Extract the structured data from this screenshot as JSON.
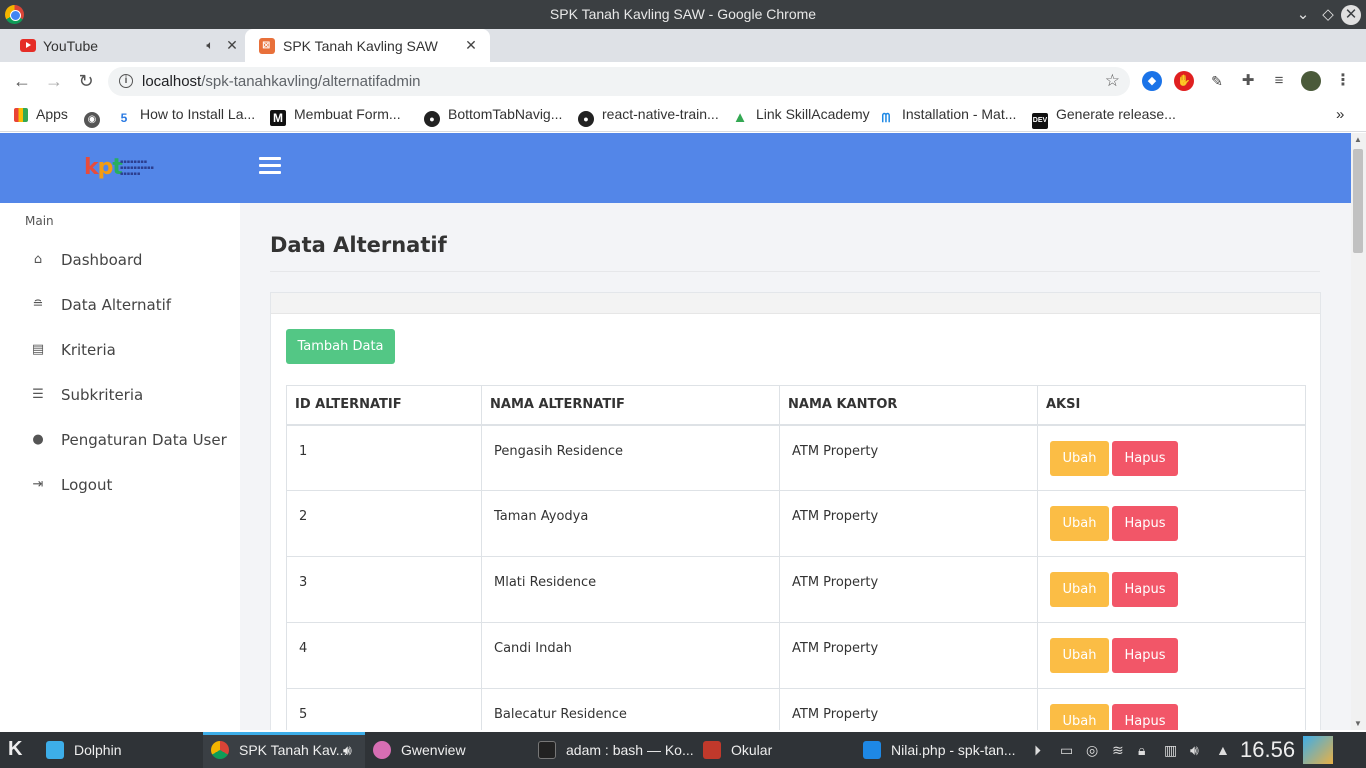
{
  "window": {
    "title": "SPK Tanah Kavling SAW - Google Chrome"
  },
  "tabs": [
    {
      "label": "YouTube"
    },
    {
      "label": "SPK Tanah Kavling SAW"
    }
  ],
  "address": {
    "host": "localhost",
    "path": "/spk-tanahkavling/alternatifadmin"
  },
  "bookmarks": [
    {
      "label": "Apps",
      "icon": "apps-grid-icon"
    },
    {
      "label": "How to Install La...",
      "icon": "5-icon"
    },
    {
      "label": "Membuat Form...",
      "icon": "medium-icon"
    },
    {
      "label": "BottomTabNavig...",
      "icon": "github-icon"
    },
    {
      "label": "react-native-train...",
      "icon": "github-icon"
    },
    {
      "label": "Link SkillAcademy",
      "icon": "google-drive-icon"
    },
    {
      "label": "Installation - Mat...",
      "icon": "mui-icon"
    },
    {
      "label": "Generate release...",
      "icon": "dev-icon"
    }
  ],
  "sidebar": {
    "heading": "Main",
    "items": [
      {
        "label": "Dashboard",
        "icon": "home-icon"
      },
      {
        "label": "Data Alternatif",
        "icon": "database-icon"
      },
      {
        "label": "Kriteria",
        "icon": "list-alt-icon"
      },
      {
        "label": "Subkriteria",
        "icon": "list-icon"
      },
      {
        "label": "Pengaturan Data User",
        "icon": "user-icon"
      },
      {
        "label": "Logout",
        "icon": "logout-icon"
      }
    ]
  },
  "main": {
    "title": "Data Alternatif",
    "add_button": "Tambah Data",
    "table": {
      "columns": [
        "ID ALTERNATIF",
        "NAMA ALTERNATIF",
        "NAMA KANTOR",
        "AKSI"
      ],
      "rows": [
        {
          "id": "1",
          "nama": "Pengasih Residence",
          "kantor": "ATM Property"
        },
        {
          "id": "2",
          "nama": "Taman Ayodya",
          "kantor": "ATM Property"
        },
        {
          "id": "3",
          "nama": "Mlati Residence",
          "kantor": "ATM Property"
        },
        {
          "id": "4",
          "nama": "Candi Indah",
          "kantor": "ATM Property"
        },
        {
          "id": "5",
          "nama": "Balecatur Residence",
          "kantor": "ATM Property"
        }
      ],
      "edit_label": "Ubah",
      "delete_label": "Hapus"
    }
  },
  "logo": {
    "text": "kpt"
  },
  "taskbar": {
    "items": [
      {
        "label": "Dolphin"
      },
      {
        "label": "SPK Tanah Kav..."
      },
      {
        "label": "Gwenview"
      },
      {
        "label": "adam : bash — Ko..."
      },
      {
        "label": "Okular"
      },
      {
        "label": "Nilai.php - spk-tan..."
      }
    ],
    "clock": "16.56"
  },
  "colors": {
    "accent": "#5386e8",
    "add": "#53c785",
    "edit": "#fbbd45",
    "delete": "#f25668"
  }
}
